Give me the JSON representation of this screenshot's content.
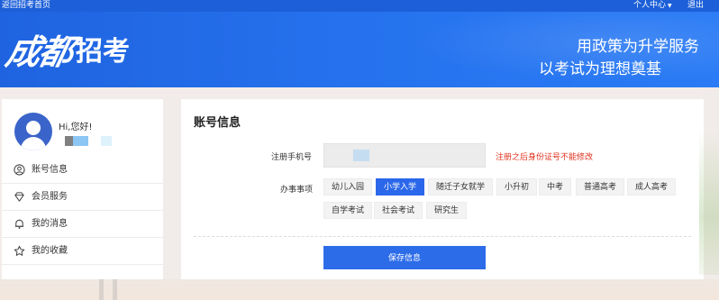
{
  "topbar": {
    "back_link": "返回招考首页",
    "user_center": "个人中心",
    "logout": "退出"
  },
  "banner": {
    "logo_script": "成都",
    "logo_plain": "招考",
    "slogan_line1": "用政策为升学服务",
    "slogan_line2": "以考试为理想奠基"
  },
  "sidebar": {
    "greeting": "Hi,您好!",
    "items": [
      {
        "label": "账号信息",
        "icon": "user-circle-icon"
      },
      {
        "label": "会员服务",
        "icon": "diamond-icon"
      },
      {
        "label": "我的消息",
        "icon": "bell-icon"
      },
      {
        "label": "我的收藏",
        "icon": "star-icon"
      }
    ]
  },
  "main": {
    "title": "账号信息",
    "phone_label": "注册手机号",
    "phone_value": "",
    "phone_note": "注册之后身份证号不能修改",
    "items_label": "办事事项",
    "chips": [
      {
        "label": "幼儿入园",
        "active": false
      },
      {
        "label": "小学入学",
        "active": true
      },
      {
        "label": "随迁子女就学",
        "active": false
      },
      {
        "label": "小升初",
        "active": false
      },
      {
        "label": "中考",
        "active": false
      },
      {
        "label": "普通高考",
        "active": false
      },
      {
        "label": "成人高考",
        "active": false
      },
      {
        "label": "自学考试",
        "active": false
      },
      {
        "label": "社会考试",
        "active": false
      },
      {
        "label": "研究生",
        "active": false
      }
    ],
    "save_label": "保存信息"
  },
  "colors": {
    "brand_blue": "#1f63e0",
    "active_chip": "#2b67ea",
    "warning_red": "#e0321f"
  }
}
